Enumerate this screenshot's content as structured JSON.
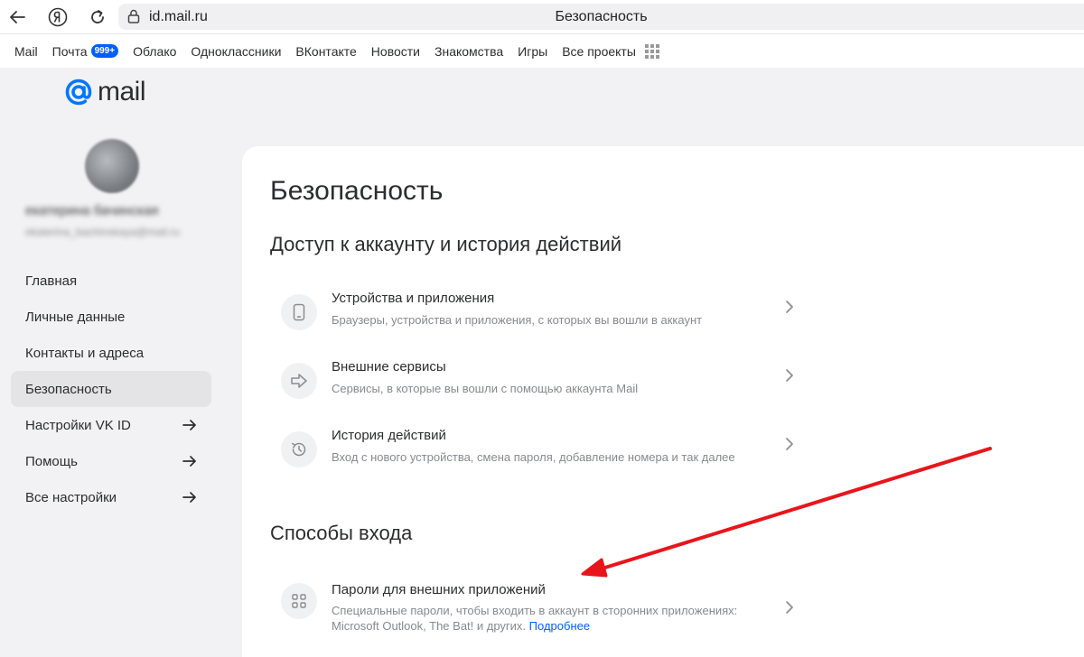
{
  "browser": {
    "url": "id.mail.ru",
    "page_title": "Безопасность"
  },
  "portal": {
    "items": [
      {
        "label": "Mail"
      },
      {
        "label": "Почта",
        "badge": "999+"
      },
      {
        "label": "Облако"
      },
      {
        "label": "Одноклассники"
      },
      {
        "label": "ВКонтакте"
      },
      {
        "label": "Новости"
      },
      {
        "label": "Знакомства"
      },
      {
        "label": "Игры"
      },
      {
        "label": "Все проекты"
      }
    ]
  },
  "logo": {
    "text": "mail"
  },
  "profile": {
    "name": "екатерина бачинская",
    "email": "ekaterina_bachinskaya@mail.ru"
  },
  "sidebar": {
    "items": [
      {
        "label": "Главная",
        "active": false,
        "external": false
      },
      {
        "label": "Личные данные",
        "active": false,
        "external": false
      },
      {
        "label": "Контакты и адреса",
        "active": false,
        "external": false
      },
      {
        "label": "Безопасность",
        "active": true,
        "external": false
      },
      {
        "label": "Настройки VK ID",
        "active": false,
        "external": true
      },
      {
        "label": "Помощь",
        "active": false,
        "external": true
      },
      {
        "label": "Все настройки",
        "active": false,
        "external": true
      }
    ]
  },
  "main": {
    "title": "Безопасность",
    "sections": [
      {
        "title": "Доступ к аккаунту и история действий",
        "rows": [
          {
            "title": "Устройства и приложения",
            "desc": "Браузеры, устройства и приложения, с которых вы вошли в аккаунт",
            "icon": "phone-icon"
          },
          {
            "title": "Внешние сервисы",
            "desc": "Сервисы, в которые вы вошли с помощью аккаунта Mail",
            "icon": "arrow-right-icon"
          },
          {
            "title": "История действий",
            "desc": "Вход с нового устройства, смена пароля, добавление номера и так далее",
            "icon": "history-icon"
          }
        ]
      },
      {
        "title": "Способы входа",
        "rows": [
          {
            "title": "Пароли для внешних приложений",
            "desc": "Специальные пароли, чтобы входить в аккаунт в сторонних приложениях: Microsoft Outlook, The Bat! и других.",
            "link": "Подробнее",
            "icon": "apps-grid-icon"
          }
        ]
      }
    ]
  },
  "colors": {
    "accent": "#005ff9",
    "annotation_arrow": "#e8151b",
    "page_bg": "#f2f2f4"
  }
}
